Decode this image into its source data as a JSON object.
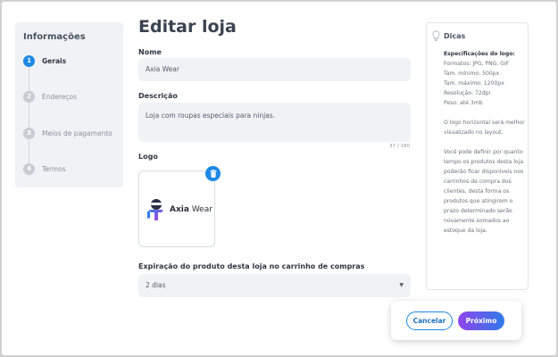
{
  "stepper": {
    "title": "Informações",
    "steps": [
      {
        "number": "1",
        "label": "Gerais",
        "active": true
      },
      {
        "number": "2",
        "label": "Endereços",
        "active": false
      },
      {
        "number": "3",
        "label": "Meios de pagamento",
        "active": false
      },
      {
        "number": "4",
        "label": "Termos",
        "active": false
      }
    ]
  },
  "page": {
    "title": "Editar loja"
  },
  "form": {
    "name_label": "Nome",
    "name_value": "Axia Wear",
    "description_label": "Descrição",
    "description_value": "Loja com roupas especiais para ninjas.",
    "char_count": "37 / 180",
    "logo_label": "Logo",
    "logo_brand_bold": "Axia",
    "logo_brand_regular": "Wear",
    "expiration_label": "Expiração do produto desta loja no carrinho de compras",
    "expiration_value": "2 dias"
  },
  "tips": {
    "title": "Dicas",
    "spec_title": "Especificações do logo:",
    "spec_lines": [
      "Formatos: JPG, PNG, GIF",
      "Tam. mínimo: 500px",
      "Tam. máximo: 1200px",
      "Resolução: 72dpi",
      "Peso: até 3mb"
    ],
    "paragraph1": "O logo horizontal será melhor visualizado no layout.",
    "paragraph2": "Você pode definir por quanto tempo os produtos desta loja poderão ficar disponíveis nos carrinhos de compra dos clientes, desta forma os produtos que atingirem o prazo determinado serão novamente somados ao estoque da loja."
  },
  "actions": {
    "cancel_label": "Cancelar",
    "next_label": "Próximo"
  },
  "colors": {
    "accent": "#1e88e5",
    "gradient_start": "#8e44ec",
    "gradient_end": "#2f7be8",
    "input_bg": "#f1f2f5"
  },
  "icons": {
    "tips": "lightbulb-icon",
    "delete": "trash-icon",
    "select": "caret-down-icon"
  }
}
